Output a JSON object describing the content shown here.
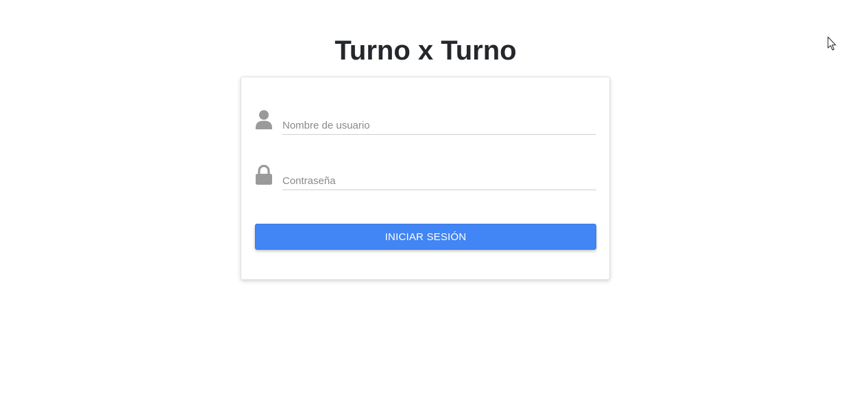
{
  "app": {
    "title": "Turno x Turno"
  },
  "login_form": {
    "username": {
      "icon": "user-icon",
      "placeholder": "Nombre de usuario",
      "value": ""
    },
    "password": {
      "icon": "lock-icon",
      "placeholder": "Contraseña",
      "value": ""
    },
    "submit_label": "INICIAR SESIÓN"
  },
  "colors": {
    "accent": "#4285f4",
    "icon": "#9a9a9a",
    "title": "#24272b"
  }
}
